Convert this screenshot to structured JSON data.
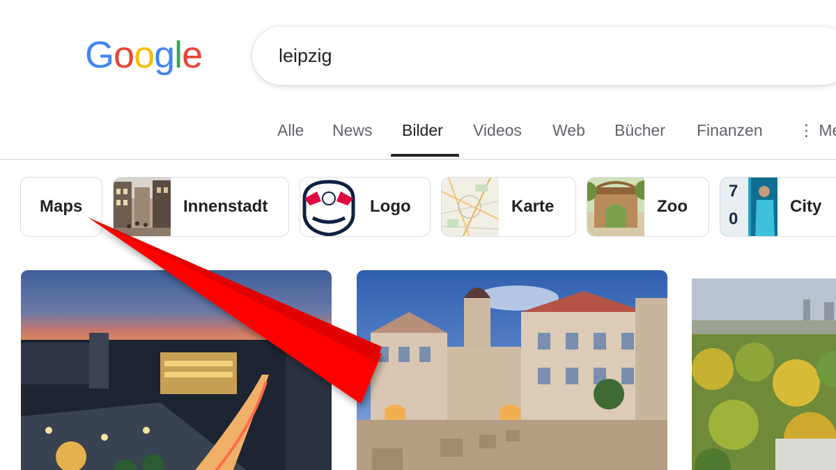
{
  "logo": {
    "letters": [
      "G",
      "o",
      "o",
      "g",
      "l",
      "e"
    ],
    "colors": [
      "#4285F4",
      "#EA4335",
      "#FBBC05",
      "#4285F4",
      "#34A853",
      "#EA4335"
    ]
  },
  "search": {
    "value": "leipzig"
  },
  "tabs": [
    {
      "label": "Alle"
    },
    {
      "label": "News"
    },
    {
      "label": "Bilder",
      "active": true
    },
    {
      "label": "Videos"
    },
    {
      "label": "Web"
    },
    {
      "label": "Bücher"
    },
    {
      "label": "Finanzen"
    },
    {
      "label": "⋮ Me"
    }
  ],
  "chips": [
    {
      "label": "Maps"
    },
    {
      "label": "Innenstadt"
    },
    {
      "label": "Logo"
    },
    {
      "label": "Karte"
    },
    {
      "label": "Zoo"
    },
    {
      "label": "City",
      "score": [
        "7",
        "0"
      ]
    }
  ],
  "colors": {
    "active_tab": "#202124",
    "inactive_tab": "#5f6368",
    "annotation_arrow": "#ff0000"
  },
  "icons": {
    "more": "more-vert-icon"
  }
}
